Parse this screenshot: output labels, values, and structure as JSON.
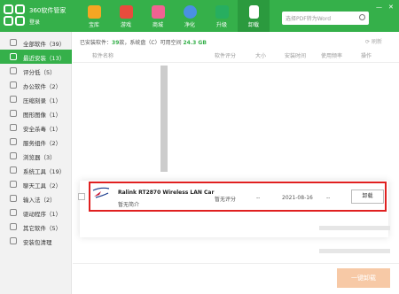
{
  "colors": {
    "brand": "#35b04a",
    "highlight": "#e02020",
    "uninstall_all": "#f7c9a6"
  },
  "header": {
    "app_title": "360软件管家",
    "login": "登录",
    "tabs": [
      {
        "label": "宝库",
        "icon": "star-icon",
        "color": "#f5a623"
      },
      {
        "label": "游戏",
        "icon": "gamepad-icon",
        "color": "#e84c3d"
      },
      {
        "label": "商城",
        "icon": "shop-icon",
        "color": "#f06292"
      },
      {
        "label": "净化",
        "icon": "clean-icon",
        "color": "#4a90e2"
      },
      {
        "label": "升级",
        "icon": "upgrade-icon",
        "color": "#27ae60"
      },
      {
        "label": "卸载",
        "icon": "trash-icon",
        "color": "#2b9a3e"
      }
    ],
    "search_placeholder": "选择PDF转为Word"
  },
  "sidebar": {
    "items": [
      {
        "label": "全部软件（39）",
        "icon": "grid-icon"
      },
      {
        "label": "最近安装（13）",
        "icon": "clock-icon"
      },
      {
        "label": "评分低（5）",
        "icon": "thumb-down-icon"
      },
      {
        "label": "办公软件（2）",
        "icon": "office-icon"
      },
      {
        "label": "压缩刻录（1）",
        "icon": "archive-icon"
      },
      {
        "label": "图形图像（1）",
        "icon": "image-icon"
      },
      {
        "label": "安全杀毒（1）",
        "icon": "shield-icon"
      },
      {
        "label": "服务组件（2）",
        "icon": "component-icon"
      },
      {
        "label": "浏览器（3）",
        "icon": "browser-icon"
      },
      {
        "label": "系统工具（19）",
        "icon": "tools-icon"
      },
      {
        "label": "聊天工具（2）",
        "icon": "chat-icon"
      },
      {
        "label": "输入法（2）",
        "icon": "keyboard-icon"
      },
      {
        "label": "驱动程序（1）",
        "icon": "driver-icon"
      },
      {
        "label": "其它软件（5）",
        "icon": "other-icon"
      },
      {
        "label": "安装包清理",
        "icon": "package-icon"
      }
    ]
  },
  "main": {
    "status_prefix": "已安装软件：",
    "installed_count": "39",
    "status_mid": "款，系统盘（C）可用空间",
    "free_space": "24.3 GB",
    "refresh": "刷新",
    "columns": [
      "软件名称",
      "软件评分",
      "大小",
      "安装时间",
      "使用频率",
      "操作"
    ],
    "row": {
      "name": "Ralink RT2870 Wireless LAN Car",
      "desc": "暂无简介",
      "rating": "暂无评分",
      "size": "--",
      "install_date": "2021-08-16",
      "frequency": "--",
      "action": "卸载"
    },
    "uninstall_all": "一键卸载"
  }
}
